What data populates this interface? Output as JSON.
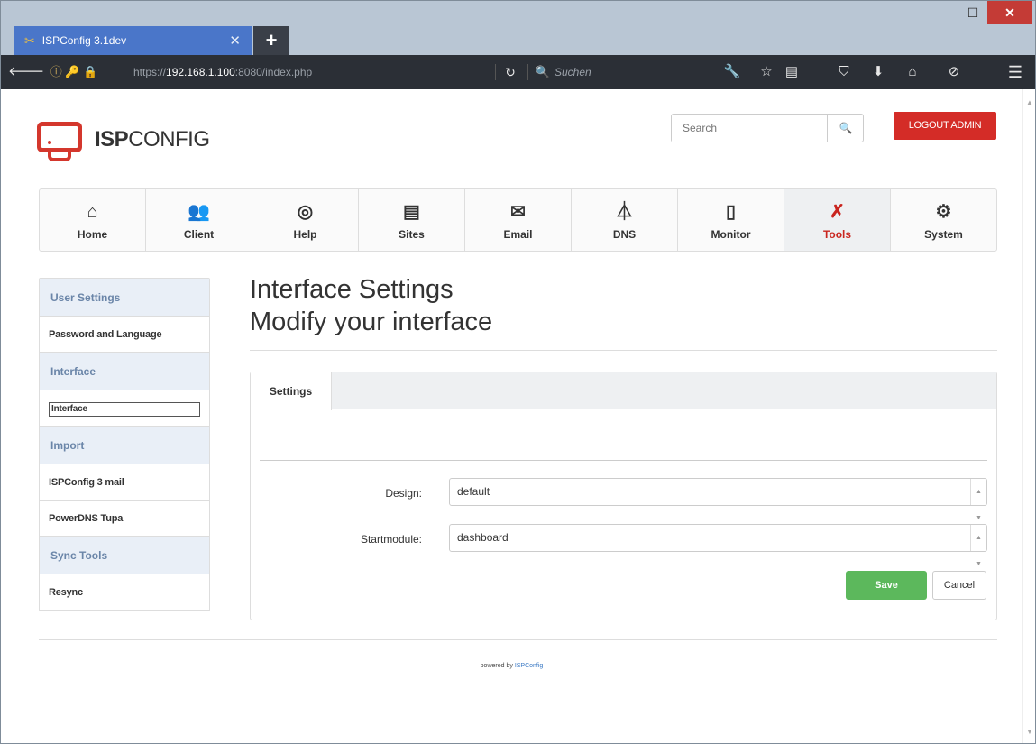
{
  "browser": {
    "tab_title": "ISPConfig 3.1dev",
    "tab_close": "✕",
    "new_tab": "+",
    "url_prefix": "https://",
    "url_host": "192.168.1.100",
    "url_rest": ":8080/index.php",
    "search_placeholder": "Suchen"
  },
  "header": {
    "logo_bold": "ISP",
    "logo_rest": "CONFIG",
    "search_placeholder": "Search",
    "logout_label": "LOGOUT ADMIN"
  },
  "main_nav": [
    {
      "label": "Home",
      "icon": "home-icon"
    },
    {
      "label": "Client",
      "icon": "users-icon"
    },
    {
      "label": "Help",
      "icon": "lifebuoy-icon"
    },
    {
      "label": "Sites",
      "icon": "browser-icon"
    },
    {
      "label": "Email",
      "icon": "envelope-icon"
    },
    {
      "label": "DNS",
      "icon": "network-icon"
    },
    {
      "label": "Monitor",
      "icon": "traffic-light-icon"
    },
    {
      "label": "Tools",
      "icon": "tools-icon",
      "active": true
    },
    {
      "label": "System",
      "icon": "gear-icon"
    }
  ],
  "sidebar": {
    "sections": [
      {
        "title": "User Settings",
        "items": [
          "Password and Language"
        ]
      },
      {
        "title": "Interface",
        "items": [
          "Interface"
        ]
      },
      {
        "title": "Import",
        "items": [
          "ISPConfig 3 mail",
          "PowerDNS Tupa"
        ]
      },
      {
        "title": "Sync Tools",
        "items": [
          "Resync"
        ]
      }
    ]
  },
  "page": {
    "title_line1": "Interface Settings",
    "title_line2": "Modify your interface"
  },
  "form": {
    "tab_label": "Settings",
    "design_label": "Design:",
    "design_value": "default",
    "startmodule_label": "Startmodule:",
    "startmodule_value": "dashboard",
    "save_label": "Save",
    "cancel_label": "Cancel"
  },
  "footer": {
    "prefix": "powered by",
    "link": "ISPConfig"
  },
  "colors": {
    "accent_red": "#d42c27",
    "save_green": "#5cb85c",
    "sidebar_header": "#6a85a8"
  }
}
